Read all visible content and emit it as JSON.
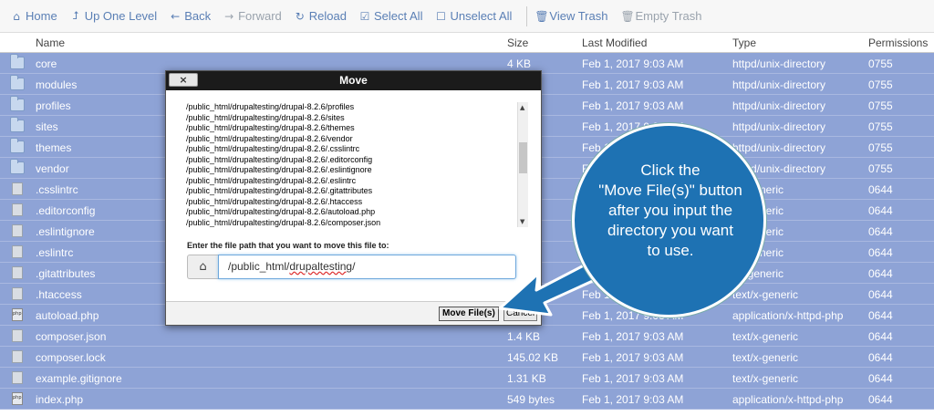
{
  "toolbar": {
    "home": "Home",
    "up": "Up One Level",
    "back": "Back",
    "forward": "Forward",
    "reload": "Reload",
    "select_all": "Select All",
    "unselect_all": "Unselect All",
    "view_trash": "View Trash",
    "empty_trash": "Empty Trash"
  },
  "table": {
    "headers": {
      "name": "Name",
      "size": "Size",
      "modified": "Last Modified",
      "type": "Type",
      "perms": "Permissions"
    },
    "rows": [
      {
        "icon": "folder-icon",
        "name": "core",
        "size": "4 KB",
        "modified": "Feb 1, 2017 9:03 AM",
        "type": "httpd/unix-directory",
        "perms": "0755"
      },
      {
        "icon": "folder-icon",
        "name": "modules",
        "size": "",
        "modified": "Feb 1, 2017 9:03 AM",
        "type": "httpd/unix-directory",
        "perms": "0755"
      },
      {
        "icon": "folder-icon",
        "name": "profiles",
        "size": "",
        "modified": "Feb 1, 2017 9:03 AM",
        "type": "httpd/unix-directory",
        "perms": "0755"
      },
      {
        "icon": "folder-icon",
        "name": "sites",
        "size": "",
        "modified": "Feb 1, 2017 9:03 AM",
        "type": "httpd/unix-directory",
        "perms": "0755"
      },
      {
        "icon": "folder-icon",
        "name": "themes",
        "size": "",
        "modified": "Feb 1, 2017 9:03 AM",
        "type": "httpd/unix-directory",
        "perms": "0755"
      },
      {
        "icon": "folder-icon",
        "name": "vendor",
        "size": "",
        "modified": "Feb 1, 2017 9:03 AM",
        "type": "httpd/unix-directory",
        "perms": "0755"
      },
      {
        "icon": "file-icon",
        "name": ".csslintrc",
        "size": "tes",
        "modified": "",
        "type": "t/x-generic",
        "perms": "0644"
      },
      {
        "icon": "file-icon",
        "name": ".editorconfig",
        "size": "tes",
        "modified": "",
        "type": "t/x-generic",
        "perms": "0644"
      },
      {
        "icon": "file-icon",
        "name": ".eslintignore",
        "size": "tes",
        "modified": "",
        "type": "t/x-generic",
        "perms": "0644"
      },
      {
        "icon": "file-icon",
        "name": ".eslintrc",
        "size": "tes",
        "modified": "",
        "type": "t/x-generic",
        "perms": "0644"
      },
      {
        "icon": "file-icon",
        "name": ".gitattributes",
        "size": "",
        "modified": "",
        "type": "t/x-generic",
        "perms": "0644"
      },
      {
        "icon": "file-icon",
        "name": ".htaccess",
        "size": "",
        "modified": "Feb 1, 2017 9:03 AM",
        "type": "text/x-generic",
        "perms": "0644"
      },
      {
        "icon": "php-file-icon",
        "name": "autoload.php",
        "size": "tes",
        "modified": "Feb 1, 2017 9:03 AM",
        "type": "application/x-httpd-php",
        "perms": "0644"
      },
      {
        "icon": "file-icon",
        "name": "composer.json",
        "size": "1.4 KB",
        "modified": "Feb 1, 2017 9:03 AM",
        "type": "text/x-generic",
        "perms": "0644"
      },
      {
        "icon": "file-icon",
        "name": "composer.lock",
        "size": "145.02 KB",
        "modified": "Feb 1, 2017 9:03 AM",
        "type": "text/x-generic",
        "perms": "0644"
      },
      {
        "icon": "file-icon",
        "name": "example.gitignore",
        "size": "1.31 KB",
        "modified": "Feb 1, 2017 9:03 AM",
        "type": "text/x-generic",
        "perms": "0644"
      },
      {
        "icon": "php-file-icon",
        "name": "index.php",
        "size": "549 bytes",
        "modified": "Feb 1, 2017 9:03 AM",
        "type": "application/x-httpd-php",
        "perms": "0644"
      }
    ]
  },
  "modal": {
    "title": "Move",
    "close": "×",
    "files": [
      "/public_html/drupaltesting/drupal-8.2.6/profiles",
      "/public_html/drupaltesting/drupal-8.2.6/sites",
      "/public_html/drupaltesting/drupal-8.2.6/themes",
      "/public_html/drupaltesting/drupal-8.2.6/vendor",
      "/public_html/drupaltesting/drupal-8.2.6/.csslintrc",
      "/public_html/drupaltesting/drupal-8.2.6/.editorconfig",
      "/public_html/drupaltesting/drupal-8.2.6/.eslintignore",
      "/public_html/drupaltesting/drupal-8.2.6/.eslintrc",
      "/public_html/drupaltesting/drupal-8.2.6/.gitattributes",
      "/public_html/drupaltesting/drupal-8.2.6/.htaccess",
      "/public_html/drupaltesting/drupal-8.2.6/autoload.php",
      "/public_html/drupaltesting/drupal-8.2.6/composer.json"
    ],
    "label": "Enter the file path that you want to move this file to:",
    "path_prefix": "/public_html/",
    "path_underlined": "drupaltesting",
    "path_suffix": "/",
    "move_button": "Move File(s)",
    "cancel_button": "Cancel"
  },
  "callout": {
    "lines": [
      "Click the",
      "\"Move File(s)\" button",
      "after you input the",
      "directory you want",
      "to use."
    ],
    "color": "#1e72b3"
  }
}
